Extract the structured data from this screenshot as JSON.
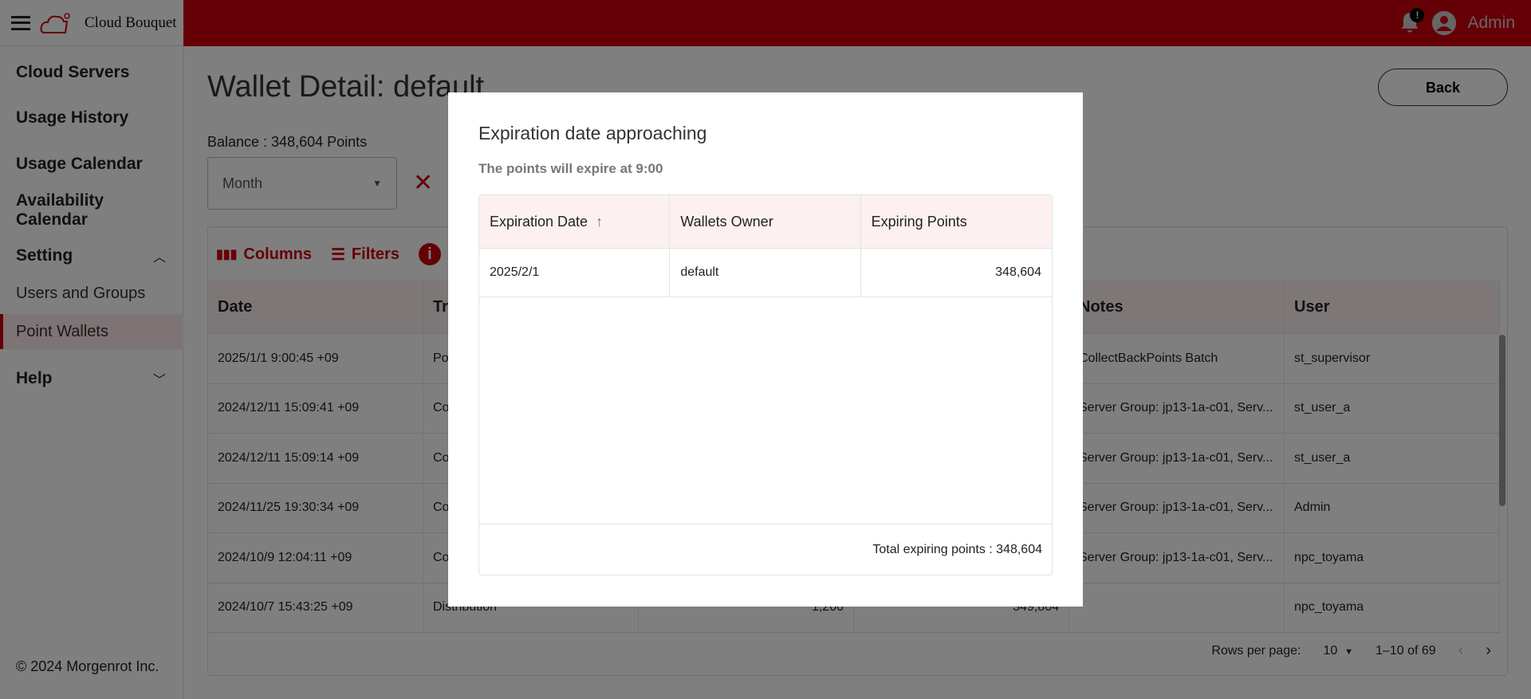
{
  "app": {
    "brand": "Cloud Bouquet",
    "user": "Admin",
    "notification_badge": "!",
    "accent": "#cc000e"
  },
  "sidebar": {
    "items": [
      {
        "label": "Cloud Servers"
      },
      {
        "label": "Usage History"
      },
      {
        "label": "Usage Calendar"
      },
      {
        "label": "Availability Calendar"
      },
      {
        "label": "Setting",
        "expanded": true
      },
      {
        "label": "Users and Groups"
      },
      {
        "label": "Point Wallets",
        "active": true
      },
      {
        "label": "Help",
        "expanded": false
      }
    ],
    "copyright": "© 2024 Morgenrot Inc."
  },
  "main": {
    "title": "Wallet Detail: default",
    "back_label": "Back",
    "balance": "Balance : 348,604 Points",
    "period_select": "Month",
    "toolbar": {
      "columns": "Columns",
      "filters": "Filters"
    },
    "grid": {
      "headers": [
        "Date",
        "Tr",
        "",
        "",
        "Notes",
        "User"
      ],
      "rows": [
        [
          "2025/1/1 9:00:45 +09",
          "Po",
          "",
          "",
          "CollectBackPoints Batch",
          "st_supervisor"
        ],
        [
          "2024/12/11 15:09:41 +09",
          "Co",
          "",
          "",
          "Server Group: jp13-1a-c01, Serv...",
          "st_user_a"
        ],
        [
          "2024/12/11 15:09:14 +09",
          "Co",
          "",
          "",
          "Server Group: jp13-1a-c01, Serv...",
          "st_user_a"
        ],
        [
          "2024/11/25 19:30:34 +09",
          "Co",
          "",
          "",
          "Server Group: jp13-1a-c01, Serv...",
          "Admin"
        ],
        [
          "2024/10/9 12:04:11 +09",
          "Co",
          "",
          "",
          "Server Group: jp13-1a-c01, Serv...",
          "npc_toyama"
        ],
        [
          "2024/10/7 15:43:25 +09",
          "Distribution",
          "1,200",
          "349,804",
          "",
          "npc_toyama"
        ]
      ],
      "rows_per_page_label": "Rows per page:",
      "rows_per_page": "10",
      "range": "1–10 of 69"
    }
  },
  "modal": {
    "title": "Expiration date approaching",
    "subtitle": "The points will expire at 9:00",
    "headers": [
      "Expiration Date",
      "Wallets Owner",
      "Expiring Points"
    ],
    "sort_indicator": "↑",
    "rows": [
      [
        "2025/2/1",
        "default",
        "348,604"
      ]
    ],
    "total": "Total expiring points : 348,604"
  }
}
